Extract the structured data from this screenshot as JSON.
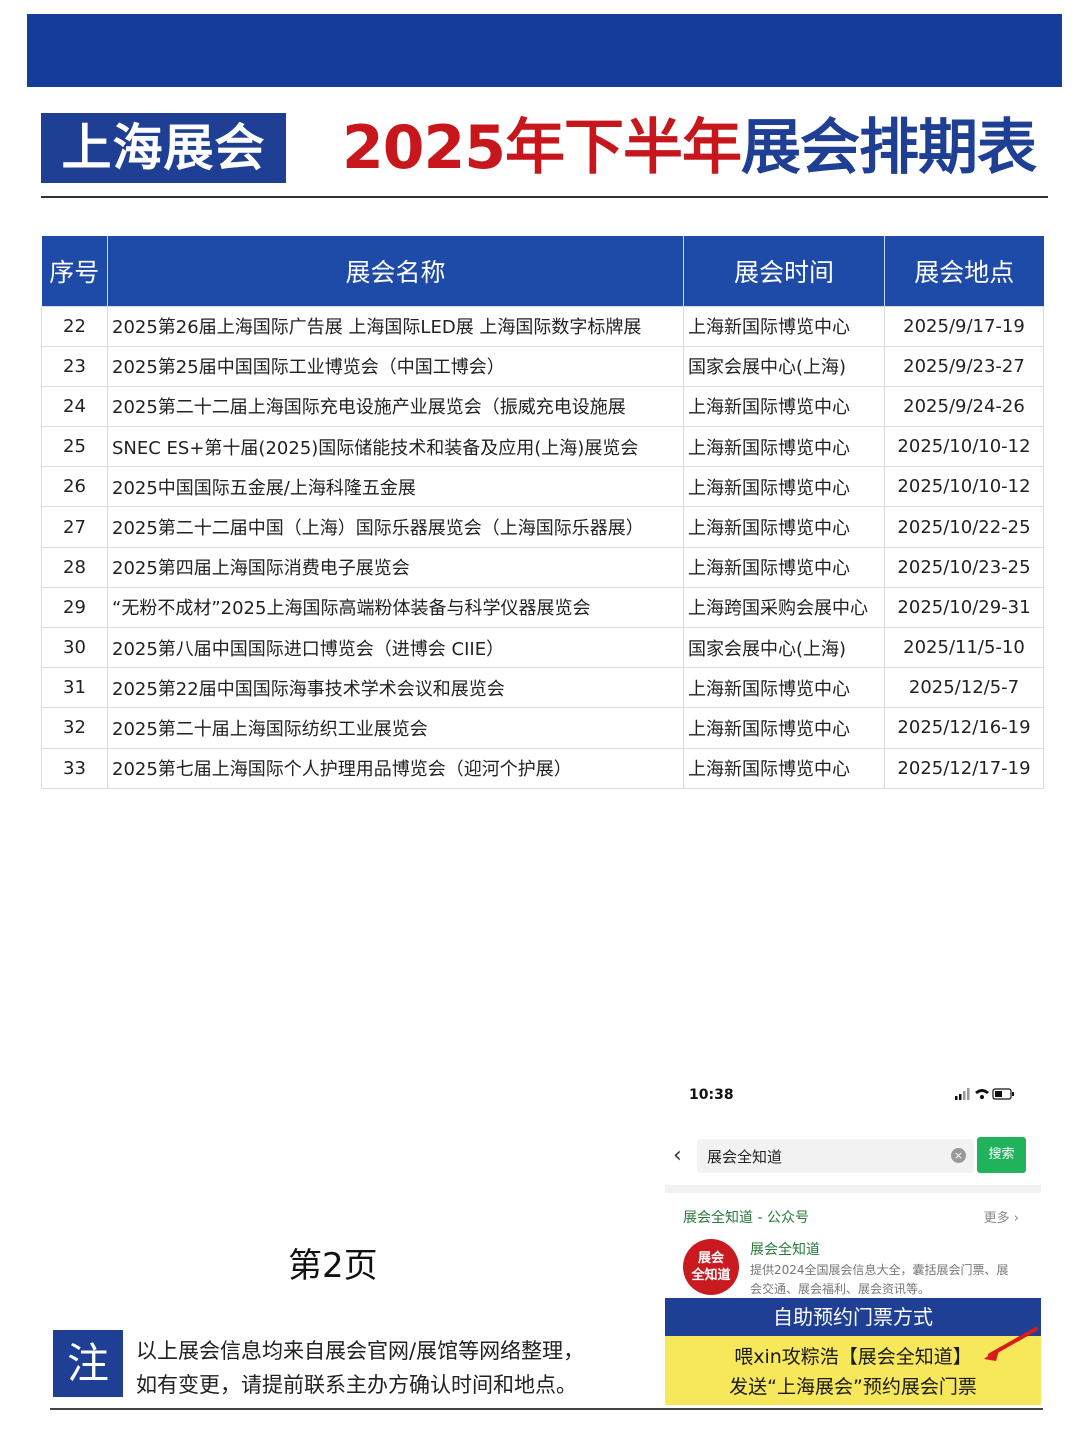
{
  "header": {
    "badge": "上海展会",
    "title_red": "2025年下半年",
    "title_blue": "展会排期表"
  },
  "table": {
    "columns": [
      "序号",
      "展会名称",
      "展会时间",
      "展会地点"
    ],
    "rows": [
      {
        "no": "22",
        "name": "2025第26届上海国际广告展 上海国际LED展 上海国际数字标牌展",
        "venue": "上海新国际博览中心",
        "date": "2025/9/17-19"
      },
      {
        "no": "23",
        "name": "2025第25届中国国际工业博览会（中国工博会）",
        "venue": "国家会展中心(上海)",
        "date": "2025/9/23-27"
      },
      {
        "no": "24",
        "name": "2025第二十二届上海国际充电设施产业展览会（振威充电设施展",
        "venue": "上海新国际博览中心",
        "date": "2025/9/24-26"
      },
      {
        "no": "25",
        "name": "SNEC ES+第十届(2025)国际储能技术和装备及应用(上海)展览会",
        "venue": "上海新国际博览中心",
        "date": "2025/10/10-12"
      },
      {
        "no": "26",
        "name": "2025中国国际五金展/上海科隆五金展",
        "venue": "上海新国际博览中心",
        "date": "2025/10/10-12"
      },
      {
        "no": "27",
        "name": "2025第二十二届中国（上海）国际乐器展览会（上海国际乐器展）",
        "venue": "上海新国际博览中心",
        "date": "2025/10/22-25"
      },
      {
        "no": "28",
        "name": "2025第四届上海国际消费电子展览会",
        "venue": "上海新国际博览中心",
        "date": "2025/10/23-25"
      },
      {
        "no": "29",
        "name": "“无粉不成材”2025上海国际高端粉体装备与科学仪器展览会",
        "venue": "上海跨国采购会展中心",
        "date": "2025/10/29-31"
      },
      {
        "no": "30",
        "name": "2025第八届中国国际进口博览会（进博会 CIIE）",
        "venue": "国家会展中心(上海)",
        "date": "2025/11/5-10"
      },
      {
        "no": "31",
        "name": "2025第22届中国国际海事技术学术会议和展览会",
        "venue": "上海新国际博览中心",
        "date": "2025/12/5-7"
      },
      {
        "no": "32",
        "name": "2025第二十届上海国际纺织工业展览会",
        "venue": "上海新国际博览中心",
        "date": "2025/12/16-19"
      },
      {
        "no": "33",
        "name": "2025第七届上海国际个人护理用品博览会（迎河个护展）",
        "venue": "上海新国际博览中心",
        "date": "2025/12/17-19"
      }
    ]
  },
  "page_label": "第2页",
  "note": {
    "badge": "注",
    "line1": "以上展会信息均来自展会官网/展馆等网络整理，",
    "line2": "如有变更，请提前联系主办方确认时间和地点。"
  },
  "phone": {
    "time": "10:38",
    "status_icons": "signal-icon wifi-icon battery-icon",
    "search_value": "展会全知道",
    "search_button": "搜索",
    "account_head": "展会全知道 - 公众号",
    "more": "更多",
    "avatar_text_1": "展会",
    "avatar_text_2": "全知道",
    "account_name": "展会全知道",
    "account_desc": "提供2024全国展会信息大全，囊括展会门票、展会交通、展会福利、展会资讯等。",
    "cta_blue": "自助预约门票方式",
    "cta_line1": "喂xin攻粽浩【展会全知道】",
    "cta_line2": "发送“上海展会”预约展会门票"
  },
  "colors": {
    "brand_blue": "#1e3f94",
    "title_red": "#c8161d",
    "header_blue": "#1e4aa8",
    "cta_yellow": "#f7e75b",
    "search_green": "#21b35c"
  }
}
